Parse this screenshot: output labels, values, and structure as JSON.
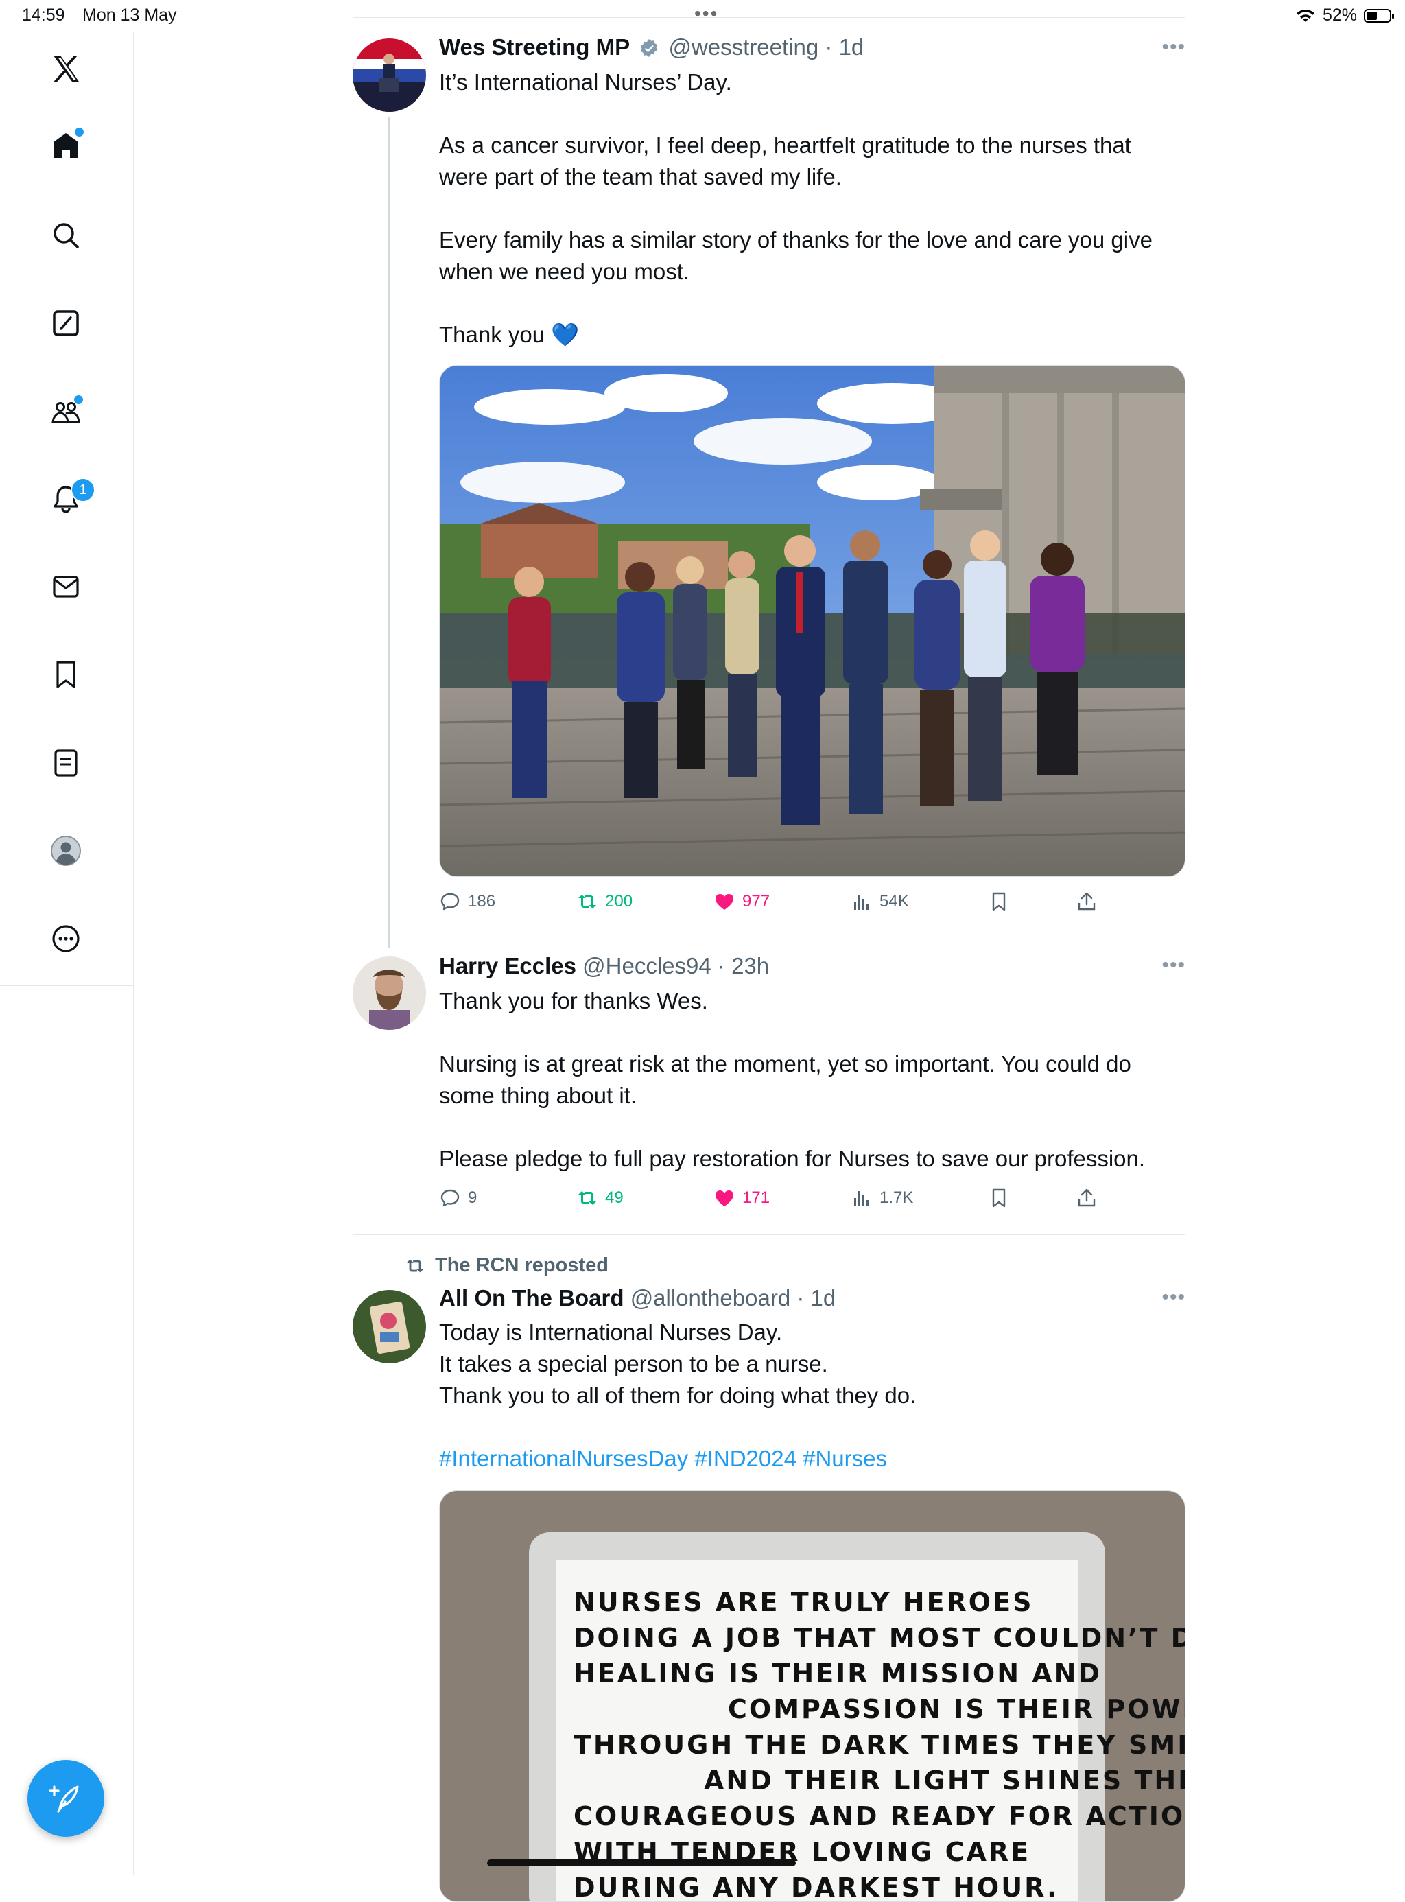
{
  "status_bar": {
    "time": "14:59",
    "date": "Mon 13 May",
    "battery": "52%",
    "battery_level": 0.52
  },
  "sidebar": {
    "items": [
      {
        "name": "home",
        "icon": "home-icon"
      },
      {
        "name": "explore",
        "icon": "search-icon"
      },
      {
        "name": "grok",
        "icon": "grok-icon"
      },
      {
        "name": "communities",
        "icon": "communities-icon"
      },
      {
        "name": "notifications",
        "icon": "bell-icon",
        "badge": "1"
      },
      {
        "name": "messages",
        "icon": "mail-icon"
      },
      {
        "name": "bookmarks",
        "icon": "bookmark-icon"
      },
      {
        "name": "lists",
        "icon": "list-icon"
      },
      {
        "name": "profile",
        "icon": "avatar-icon"
      },
      {
        "name": "more",
        "icon": "more-circle-icon"
      }
    ],
    "compose_icon": "compose-feather-icon"
  },
  "posts": [
    {
      "name": "Wes Streeting MP",
      "verified": true,
      "handle": "@wesstreeting",
      "sep": "·",
      "time": "1d",
      "text": [
        "It’s International Nurses’ Day.",
        "As a cancer survivor, I feel deep, heartfelt gratitude to the nurses that were part of the team that saved my life.",
        "Every family has a similar story of thanks for the love and care you give when we need you most.",
        "Thank you 💙"
      ],
      "media_alt": "Group photo of nurses and staff on a rooftop terrace",
      "stats": {
        "replies": "186",
        "reposts": "200",
        "likes": "977",
        "views": "54K"
      }
    },
    {
      "name": "Harry Eccles",
      "handle": "@Heccles94",
      "sep": "·",
      "time": "23h",
      "text": [
        "Thank you for thanks Wes.",
        "Nursing is at great risk at the moment, yet so important. You could do some thing about it.",
        "Please pledge to full pay restoration for Nurses to save our profession."
      ],
      "stats": {
        "replies": "9",
        "reposts": "49",
        "likes": "171",
        "views": "1.7K"
      }
    },
    {
      "repost_label": "The RCN reposted",
      "name": "All On The Board",
      "handle": "@allontheboard",
      "sep": "·",
      "time": "1d",
      "text": [
        "Today is International Nurses Day.",
        "It takes a special person to be a nurse.",
        "Thank you to all of them for doing what they do."
      ],
      "hashtags": "#InternationalNursesDay #IND2024 #Nurses",
      "board_lines": [
        "NURSES ARE TRULY HEROES",
        "DOING A JOB THAT MOST COULDN’T DO,",
        "HEALING IS THEIR MISSION AND",
        "COMPASSION IS THEIR POWER;",
        "THROUGH THE DARK TIMES THEY SMILE",
        "AND THEIR LIGHT SHINES THROUGH,",
        "COURAGEOUS AND READY FOR ACTION",
        "WITH TENDER LOVING CARE",
        "DURING ANY DARKEST HOUR."
      ]
    }
  ],
  "colors": {
    "accent": "#1d9bf0",
    "like": "#f91880",
    "repost": "#00ba7c",
    "muted": "#536471"
  }
}
